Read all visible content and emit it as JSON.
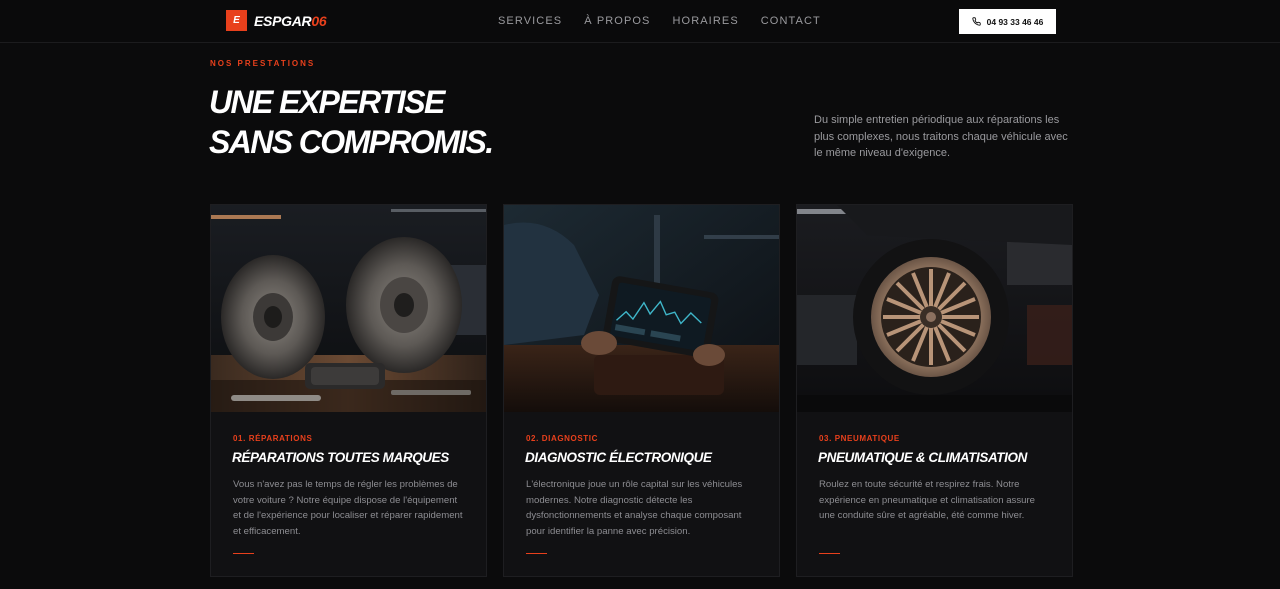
{
  "brand": {
    "logo_letter": "E",
    "name_main": "ESPGAR",
    "name_accent": "06",
    "accent_color": "#e8401c"
  },
  "nav": {
    "links": [
      "SERVICES",
      "À PROPOS",
      "HORAIRES",
      "CONTACT"
    ],
    "phone_label": "04 93 33 46 46",
    "phone_icon": "phone-icon"
  },
  "section": {
    "eyebrow": "NOS PRESTATIONS",
    "headline_line1": "UNE EXPERTISE",
    "headline_line2": "SANS COMPROMIS.",
    "intro": "Du simple entretien périodique aux réparations les plus complexes, nous traitons chaque véhicule avec le même niveau d'exigence."
  },
  "cards": [
    {
      "number": "01. RÉPARATIONS",
      "title": "RÉPARATIONS TOUTES MARQUES",
      "text": "Vous n'avez pas le temps de régler les problèmes de votre voiture ? Notre équipe dispose de l'équipement et de l'expérience pour localiser et réparer rapidement et efficacement.",
      "image": "brake-discs-image"
    },
    {
      "number": "02. DIAGNOSTIC",
      "title": "DIAGNOSTIC ÉLECTRONIQUE",
      "text": "L'électronique joue un rôle capital sur les véhicules modernes. Notre diagnostic détecte les dysfonctionnements et analyse chaque composant pour identifier la panne avec précision.",
      "image": "diagnostic-tablet-image"
    },
    {
      "number": "03. PNEUMATIQUE",
      "title": "PNEUMATIQUE & CLIMATISATION",
      "text": "Roulez en toute sécurité et respirez frais. Notre expérience en pneumatique et climatisation assure une conduite sûre et agréable, été comme hiver.",
      "image": "wheel-tire-image"
    }
  ]
}
